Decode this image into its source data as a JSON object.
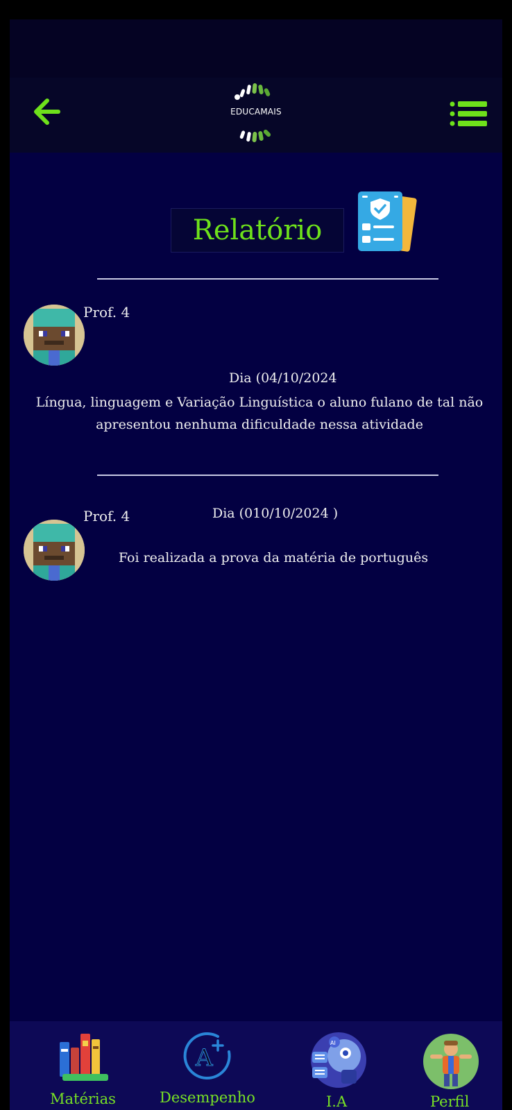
{
  "app": {
    "logo_text": "EDUCAMAIS"
  },
  "icons": {
    "back": "arrow-left-icon",
    "menu": "list-menu-icon",
    "report": "report-clipboard-icon",
    "subjects": "books-icon",
    "performance": "grade-a-plus-icon",
    "ai": "robot-ai-icon",
    "profile": "user-character-icon"
  },
  "colors": {
    "accent": "#6ee11b",
    "background": "#04003f",
    "nav": "#0d0956"
  },
  "page": {
    "title": "Relatório"
  },
  "entries": [
    {
      "author": "Prof. 4",
      "date": "Dia (04/10/2024",
      "text": "Língua, linguagem e Variação Linguística o aluno fulano de tal não apresentou nenhuma dificuldade nessa atividade"
    },
    {
      "author": "Prof. 4",
      "date": "Dia (010/10/2024 )",
      "text": "Foi realizada a prova da matéria de português"
    }
  ],
  "nav": [
    {
      "label": "Matérias"
    },
    {
      "label": "Desempenho"
    },
    {
      "label": "I.A"
    },
    {
      "label": "Perfil"
    }
  ]
}
